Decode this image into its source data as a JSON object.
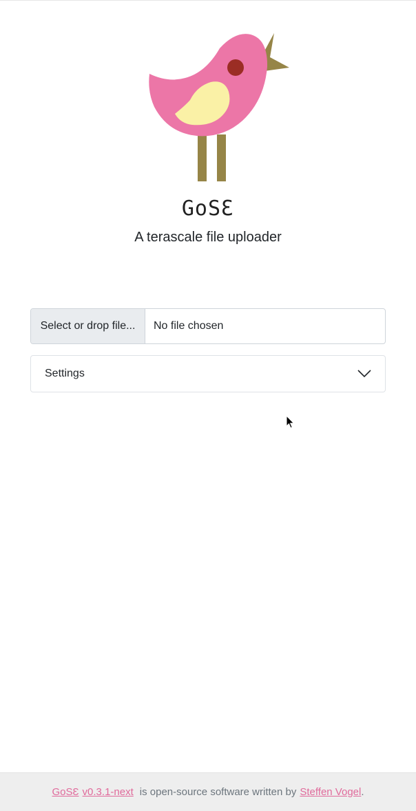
{
  "brand": {
    "name": "GoSƐ",
    "tagline": "A terascale file uploader"
  },
  "logo": {
    "icon": "bird-logo-icon",
    "colors": {
      "body": "#ec76a7",
      "wing": "#faf1a6",
      "eye": "#9b2d24",
      "beak": "#968547",
      "legs": "#968547"
    }
  },
  "upload": {
    "button_label": "Select or drop file...",
    "status": "No file chosen"
  },
  "settings": {
    "label": "Settings",
    "icon": "chevron-down-icon"
  },
  "footer": {
    "app_link": "GoSƐ",
    "version_link": "v0.3.1-next",
    "text": "is open-source software written by",
    "author_link": "Steffen Vogel",
    "period": "."
  },
  "colors": {
    "link": "#e06a9b",
    "footer_bg": "#eeeeee",
    "muted_text": "#6c757d"
  }
}
